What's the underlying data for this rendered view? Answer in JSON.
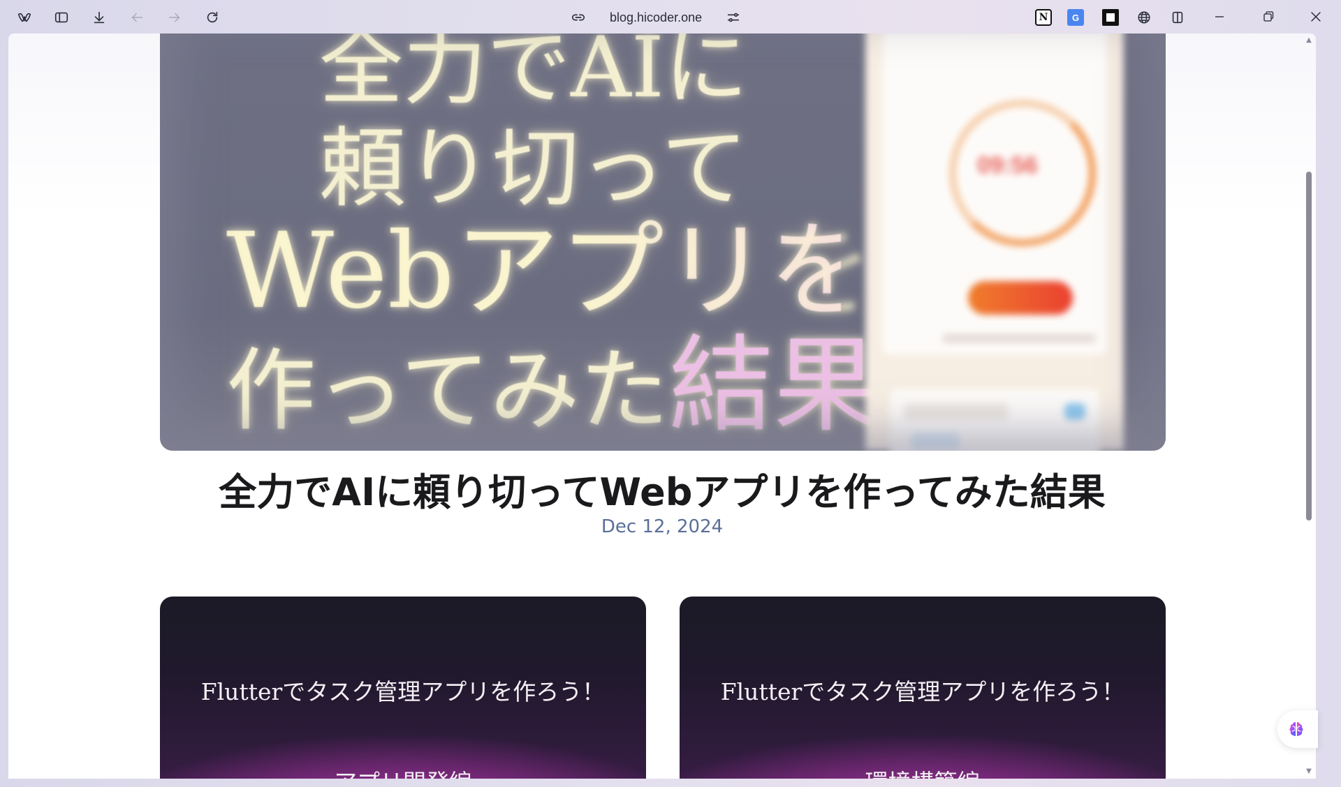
{
  "browser": {
    "url": "blog.hicoder.one",
    "extensions": {
      "notion_glyph": "N",
      "translate_glyph": "G"
    }
  },
  "hero": {
    "line1": "全力でAIに",
    "line2": "頼り切って",
    "line3": "Webアプリを",
    "line4_a": "作ってみた",
    "line4_b": "結果",
    "mock_time": "09:56"
  },
  "article": {
    "title": "全力でAIに頼り切ってWebアプリを作ってみた結果",
    "date": "Dec 12, 2024"
  },
  "cards": [
    {
      "line1": "Flutterでタスク管理アプリを作ろう！",
      "line2": "~アプリ開発編~"
    },
    {
      "line1": "Flutterでタスク管理アプリを作ろう！",
      "line2": "~環境構築編~"
    }
  ],
  "colors": {
    "date": "#5a6f98",
    "title": "#1a1a1d",
    "card_glow": "#c02a4a"
  }
}
